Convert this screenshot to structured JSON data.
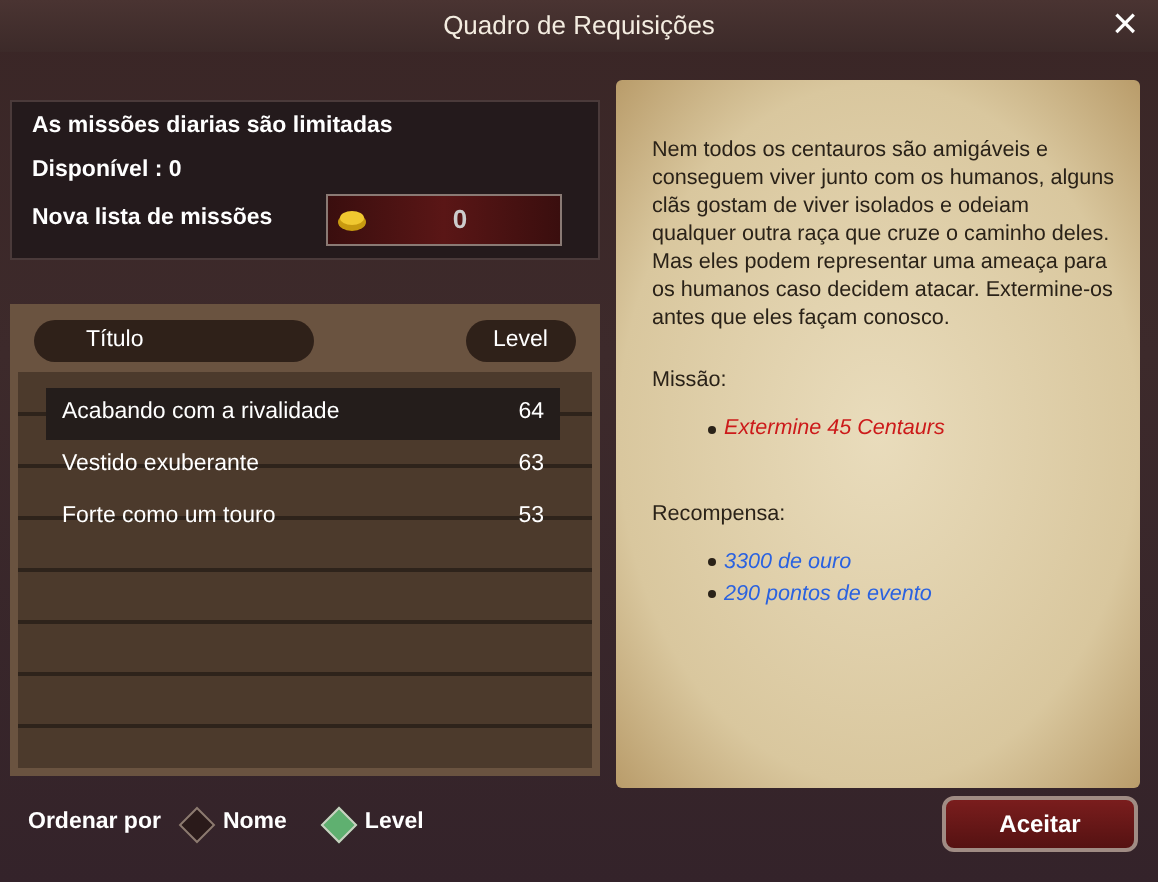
{
  "window": {
    "title": "Quadro de Requisições",
    "close": "×"
  },
  "info": {
    "limit_notice": "As missões diarias são limitadas",
    "available": "Disponível : 0",
    "new_list_label": "Nova lista de missões",
    "new_list_cost": "0"
  },
  "table": {
    "columns": [
      "Título",
      "Level"
    ],
    "rows": [
      {
        "title": "Acabando com a rivalidade",
        "level": "64",
        "selected": true
      },
      {
        "title": "Vestido exuberante",
        "level": "63",
        "selected": false
      },
      {
        "title": "Forte como um touro",
        "level": "53",
        "selected": false
      }
    ]
  },
  "details": {
    "description": "Nem todos os centauros são amigáveis e conseguem viver junto com os humanos, alguns clãs gostam de viver isolados e odeiam qualquer outra raça que cruze o caminho deles. Mas eles podem representar uma ameaça para os humanos caso decidem atacar. Extermine-os antes que eles façam conosco.",
    "mission_label": "Missão:",
    "mission_items": [
      "Extermine 45 Centaurs"
    ],
    "reward_label": "Recompensa:",
    "reward_items": [
      "3300 de ouro",
      "290 pontos de evento"
    ]
  },
  "sort": {
    "label": "Ordenar por",
    "options": [
      {
        "label": "Nome",
        "selected": false
      },
      {
        "label": "Level",
        "selected": true
      }
    ]
  },
  "buttons": [
    "Aceitar"
  ]
}
